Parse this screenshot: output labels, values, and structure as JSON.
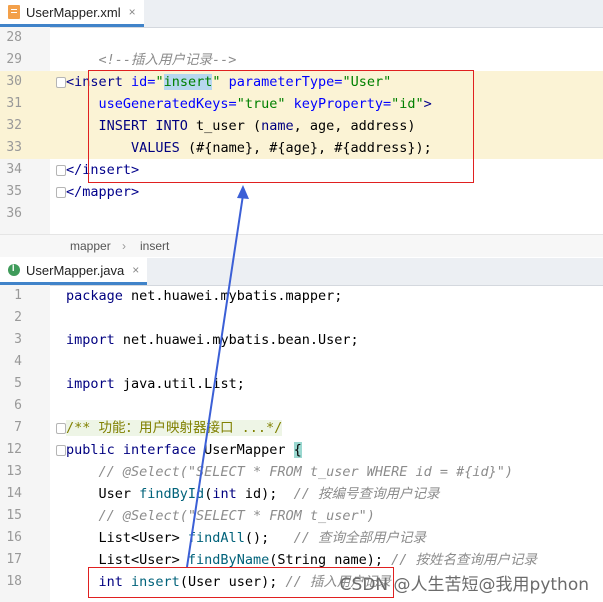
{
  "xml_tab": {
    "name": "UserMapper.xml",
    "close": "×"
  },
  "xml_lines": [
    {
      "n": "28",
      "html": ""
    },
    {
      "n": "29",
      "html": "    <span class='t-com'>&lt;!--插入用户记录--&gt;</span>"
    },
    {
      "n": "30",
      "html": "<span class='t-tag'>&lt;insert</span> <span class='t-attr'>id=</span><span class='t-val'>\"<span class='selword'>insert</span>\"</span> <span class='t-attr'>parameterType=</span><span class='t-val'>\"User\"</span>"
    },
    {
      "n": "31",
      "html": "    <span class='t-attr'>useGeneratedKeys=</span><span class='t-val'>\"true\"</span> <span class='t-attr'>keyProperty=</span><span class='t-val'>\"id\"</span><span class='t-tag'>&gt;</span>"
    },
    {
      "n": "32",
      "html": "    <span class='t-kw'>INSERT INTO</span> t_user (<span class='t-kw'>name</span>, age, address)"
    },
    {
      "n": "33",
      "html": "        <span class='t-kw'>VALUES</span> (#{name}, #{age}, #{address});"
    },
    {
      "n": "34",
      "html": "<span class='t-tag'>&lt;/insert&gt;</span>"
    },
    {
      "n": "35",
      "html": "<span class='t-tag'>&lt;/mapper&gt;</span>"
    },
    {
      "n": "36",
      "html": ""
    }
  ],
  "breadcrumb": [
    "mapper",
    "insert"
  ],
  "java_tab": {
    "name": "UserMapper.java",
    "close": "×"
  },
  "java_lines": [
    {
      "n": "1",
      "html": "<span class='t-kw'>package</span> net.huawei.mybatis.mapper;"
    },
    {
      "n": "2",
      "html": ""
    },
    {
      "n": "3",
      "html": "<span class='t-kw'>import</span> net.huawei.mybatis.bean.User;"
    },
    {
      "n": "4",
      "html": ""
    },
    {
      "n": "5",
      "html": "<span class='t-kw'>import</span> java.util.List;"
    },
    {
      "n": "6",
      "html": ""
    },
    {
      "n": "7",
      "html": "<span class='t-comgreen' style='background:#eef5e6'>/** 功能：用户映射器接口 ...*/</span>"
    },
    {
      "n": "12",
      "html": "<span class='t-kw'>public interface</span> UserMapper <span style='background:#9ad8d0'>{</span>"
    },
    {
      "n": "13",
      "html": "    <span class='t-com'>// @Select(\"SELECT * FROM t_user WHERE id = #{id}\")</span>"
    },
    {
      "n": "14",
      "html": "    User <span class='t-fn'>findById</span>(<span class='t-kw'>int</span> id);  <span class='t-com'>// 按编号查询用户记录</span>"
    },
    {
      "n": "15",
      "html": "    <span class='t-com'>// @Select(\"SELECT * FROM t_user\")</span>"
    },
    {
      "n": "16",
      "html": "    List&lt;User&gt; <span class='t-fn'>findAll</span>();   <span class='t-com'>// 查询全部用户记录</span>"
    },
    {
      "n": "17",
      "html": "    List&lt;User&gt; <span class='t-fn'>findByName</span>(String name); <span class='t-com'>// 按姓名查询用户记录</span>"
    },
    {
      "n": "18",
      "html": "    <span class='t-kw'>int</span> <span class='t-fn'>insert</span>(User user); <span class='t-com'>// 插入用户记录</span>"
    }
  ],
  "watermark": "CSDN @人生苦短@我用python",
  "colors": {
    "annotation_red": "#e02020",
    "arrow_blue": "#3b5fd6"
  }
}
